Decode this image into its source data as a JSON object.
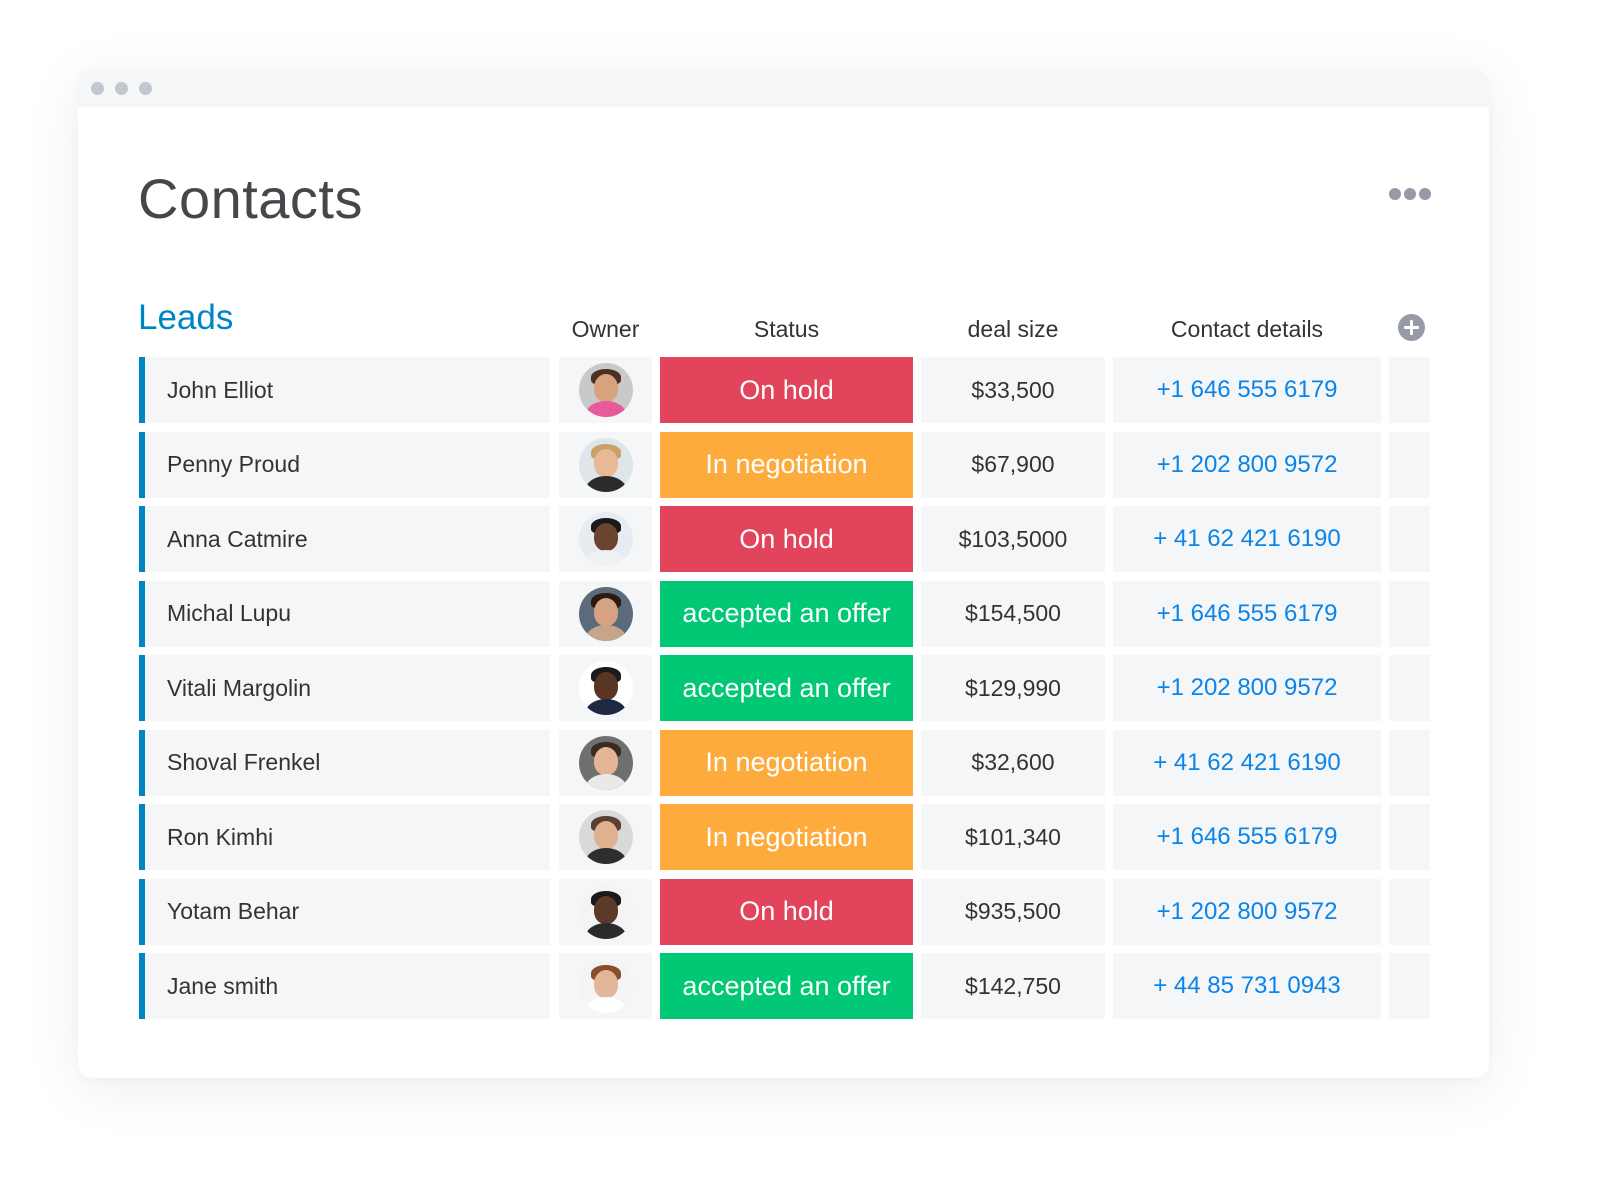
{
  "window": {
    "controls": [
      "close-dot",
      "minimize-dot",
      "maximize-dot"
    ]
  },
  "page": {
    "title": "Contacts",
    "more_icon": "more-horizontal-icon"
  },
  "group": {
    "title": "Leads",
    "color": "#0085c4"
  },
  "columns": {
    "owner": "Owner",
    "status": "Status",
    "deal_size": "deal size",
    "contact": "Contact details",
    "add_icon": "plus-circle-icon"
  },
  "status_colors": {
    "On hold": "#e2445c",
    "In negotiation": "#fdab3d",
    "accepted an offer": "#00c875"
  },
  "rows": [
    {
      "name": "John Elliot",
      "owner": "avatar-man-beard",
      "status": "On hold",
      "deal": "$33,500",
      "contact": "+1 646 555 6179"
    },
    {
      "name": "Penny Proud",
      "owner": "avatar-woman-blonde",
      "status": "In negotiation",
      "deal": "$67,900",
      "contact": "+1 202 800 9572"
    },
    {
      "name": "Anna Catmire",
      "owner": "avatar-woman-glasses",
      "status": "On hold",
      "deal": "$103,5000",
      "contact": "+ 41 62 421 6190"
    },
    {
      "name": "Michal Lupu",
      "owner": "avatar-woman-dark-hair",
      "status": "accepted an offer",
      "deal": "$154,500",
      "contact": "+1 646 555 6179"
    },
    {
      "name": "Vitali Margolin",
      "owner": "avatar-man-glasses",
      "status": "accepted an offer",
      "deal": "$129,990",
      "contact": "+1 202 800 9572"
    },
    {
      "name": "Shoval Frenkel",
      "owner": "avatar-woman-smiling",
      "status": "In negotiation",
      "deal": "$32,600",
      "contact": "+ 41 62 421 6190"
    },
    {
      "name": "Ron Kimhi",
      "owner": "avatar-man-short-hair",
      "status": "In negotiation",
      "deal": "$101,340",
      "contact": "+1 646 555 6179"
    },
    {
      "name": "Yotam Behar",
      "owner": "avatar-man-bald-beard",
      "status": "On hold",
      "deal": "$935,500",
      "contact": "+1 202 800 9572"
    },
    {
      "name": "Jane smith",
      "owner": "avatar-woman-curly-hair",
      "status": "accepted an offer",
      "deal": "$142,750",
      "contact": "+ 44 85 731 0943"
    }
  ]
}
